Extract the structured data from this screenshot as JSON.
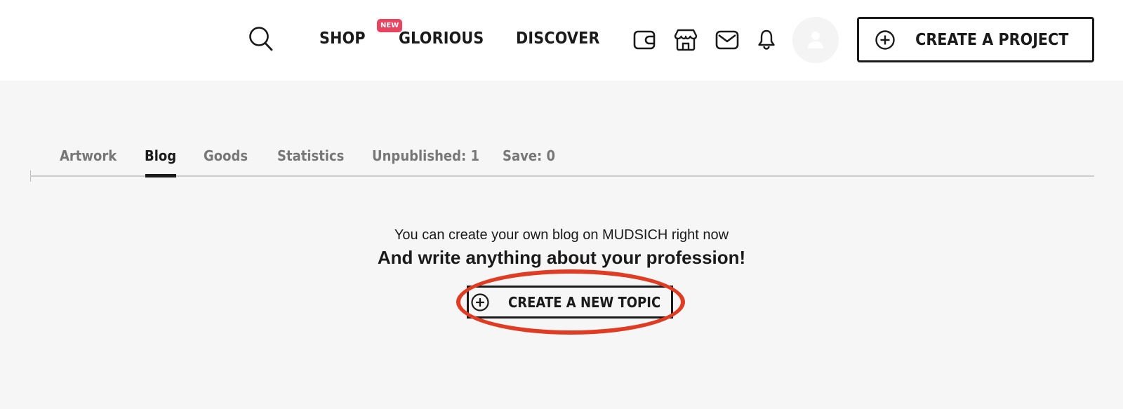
{
  "header": {
    "nav": [
      {
        "label": "SHOP"
      },
      {
        "label": "GLORIOUS",
        "badge": "NEW"
      },
      {
        "label": "DISCOVER"
      }
    ],
    "icons": [
      "search-icon",
      "wallet-icon",
      "store-icon",
      "mail-icon",
      "bell-icon",
      "user-icon"
    ],
    "create_project_label": "CREATE A PROJECT"
  },
  "tabs": [
    {
      "label": "Artwork",
      "active": false
    },
    {
      "label": "Blog",
      "active": true
    },
    {
      "label": "Goods",
      "active": false
    },
    {
      "label": "Statistics",
      "active": false
    },
    {
      "label": "Unpublished: 1",
      "active": false
    },
    {
      "label": "Save: 0",
      "active": false
    }
  ],
  "empty_state": {
    "line1": "You can create your own blog on MUDSICH right now",
    "line2": "And write anything about your profession!",
    "button_label": "CREATE A NEW TOPIC"
  },
  "colors": {
    "badge": "#e8445f",
    "highlight": "#e03c24",
    "text": "#1a1a1a",
    "muted_tab": "#777777",
    "background": "#f6f6f6"
  }
}
